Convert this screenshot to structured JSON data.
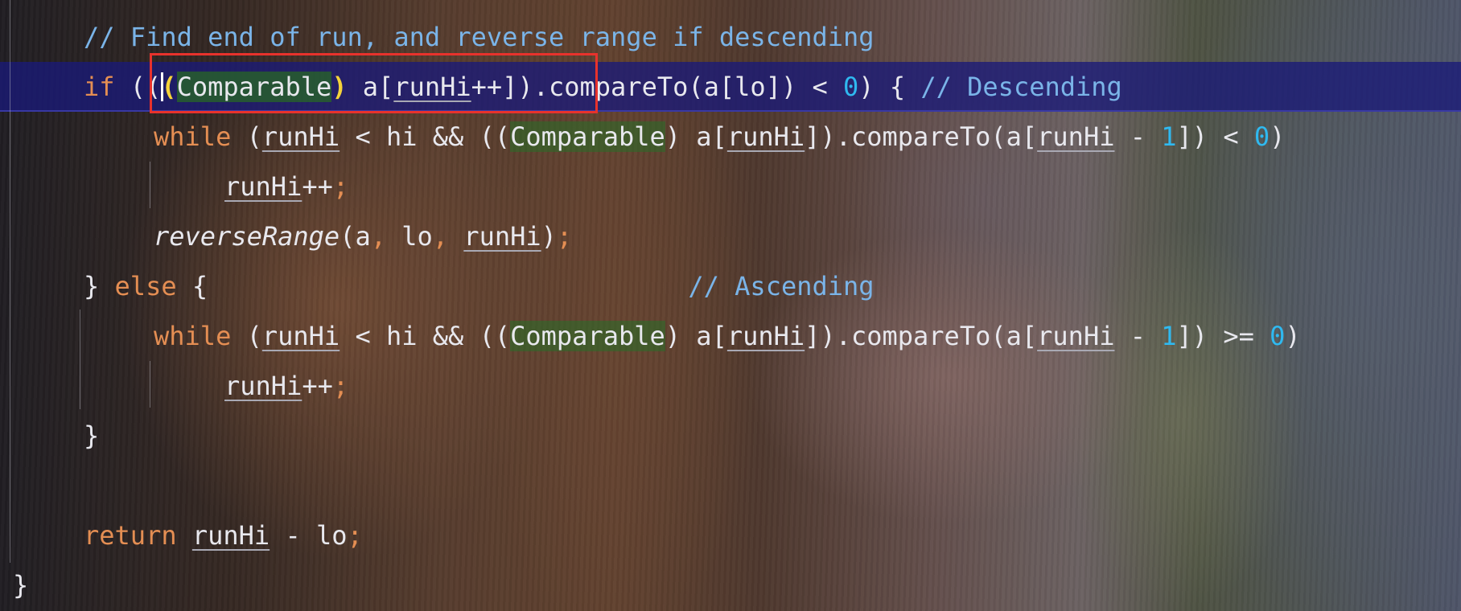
{
  "editor": {
    "lines": [
      {
        "id": "comment-find-end",
        "tokens": [
          {
            "t": "// Find end of run, and reverse range if descending",
            "c": "cm"
          }
        ]
      },
      {
        "id": "if-descending",
        "current": true,
        "tokens": [
          {
            "t": "if",
            "c": "kw"
          },
          {
            "t": " ("
          },
          {
            "t": "("
          },
          {
            "caret": true
          },
          {
            "t": "(",
            "c": "paren-match"
          },
          {
            "t": "Comparable",
            "c": "type-match"
          },
          {
            "t": ")",
            "c": "paren-match"
          },
          {
            "t": " a["
          },
          {
            "t": "runHi",
            "c": "var"
          },
          {
            "t": "++])"
          },
          {
            "t": ".compareTo(a[lo]) < "
          },
          {
            "t": "0",
            "c": "num"
          },
          {
            "t": ") { "
          },
          {
            "t": "// Descending",
            "c": "cm"
          }
        ]
      },
      {
        "id": "while-descending",
        "tokens": [
          {
            "t": "while",
            "c": "kw"
          },
          {
            "t": " ("
          },
          {
            "t": "runHi",
            "c": "var"
          },
          {
            "t": " < hi && (("
          },
          {
            "t": "Comparable",
            "c": "type"
          },
          {
            "t": ") a["
          },
          {
            "t": "runHi",
            "c": "var"
          },
          {
            "t": "]).compareTo(a["
          },
          {
            "t": "runHi",
            "c": "var"
          },
          {
            "t": " - "
          },
          {
            "t": "1",
            "c": "num"
          },
          {
            "t": "]) < "
          },
          {
            "t": "0",
            "c": "num"
          },
          {
            "t": ")"
          }
        ]
      },
      {
        "id": "increment-1",
        "tokens": [
          {
            "t": "runHi",
            "c": "var"
          },
          {
            "t": "++"
          },
          {
            "t": ";",
            "c": "semi"
          }
        ]
      },
      {
        "id": "reverse-range",
        "tokens": [
          {
            "t": "reverseRange",
            "c": "fn"
          },
          {
            "t": "(a"
          },
          {
            "t": ",",
            "c": "semi"
          },
          {
            "t": " lo"
          },
          {
            "t": ",",
            "c": "semi"
          },
          {
            "t": " "
          },
          {
            "t": "runHi",
            "c": "var"
          },
          {
            "t": ")"
          },
          {
            "t": ";",
            "c": "semi"
          }
        ]
      },
      {
        "id": "else-branch",
        "tokens": [
          {
            "t": "} "
          },
          {
            "t": "else",
            "c": "kw"
          },
          {
            "t": " {                               "
          },
          {
            "t": "// Ascending",
            "c": "cm"
          }
        ]
      },
      {
        "id": "while-ascending",
        "tokens": [
          {
            "t": "while",
            "c": "kw"
          },
          {
            "t": " ("
          },
          {
            "t": "runHi",
            "c": "var"
          },
          {
            "t": " < hi && (("
          },
          {
            "t": "Comparable",
            "c": "type"
          },
          {
            "t": ") a["
          },
          {
            "t": "runHi",
            "c": "var"
          },
          {
            "t": "]).compareTo(a["
          },
          {
            "t": "runHi",
            "c": "var"
          },
          {
            "t": " - "
          },
          {
            "t": "1",
            "c": "num"
          },
          {
            "t": "]) >= "
          },
          {
            "t": "0",
            "c": "num"
          },
          {
            "t": ")"
          }
        ]
      },
      {
        "id": "increment-2",
        "tokens": [
          {
            "t": "runHi",
            "c": "var"
          },
          {
            "t": "++"
          },
          {
            "t": ";",
            "c": "semi"
          }
        ]
      },
      {
        "id": "close-if",
        "tokens": [
          {
            "t": "}"
          }
        ]
      },
      {
        "id": "blank",
        "tokens": []
      },
      {
        "id": "return-statement",
        "tokens": [
          {
            "t": "return",
            "c": "kw"
          },
          {
            "t": " "
          },
          {
            "t": "runHi",
            "c": "var"
          },
          {
            "t": " - lo"
          },
          {
            "t": ";",
            "c": "semi"
          }
        ]
      },
      {
        "id": "close-method",
        "tokens": [
          {
            "t": "}"
          }
        ]
      }
    ]
  }
}
